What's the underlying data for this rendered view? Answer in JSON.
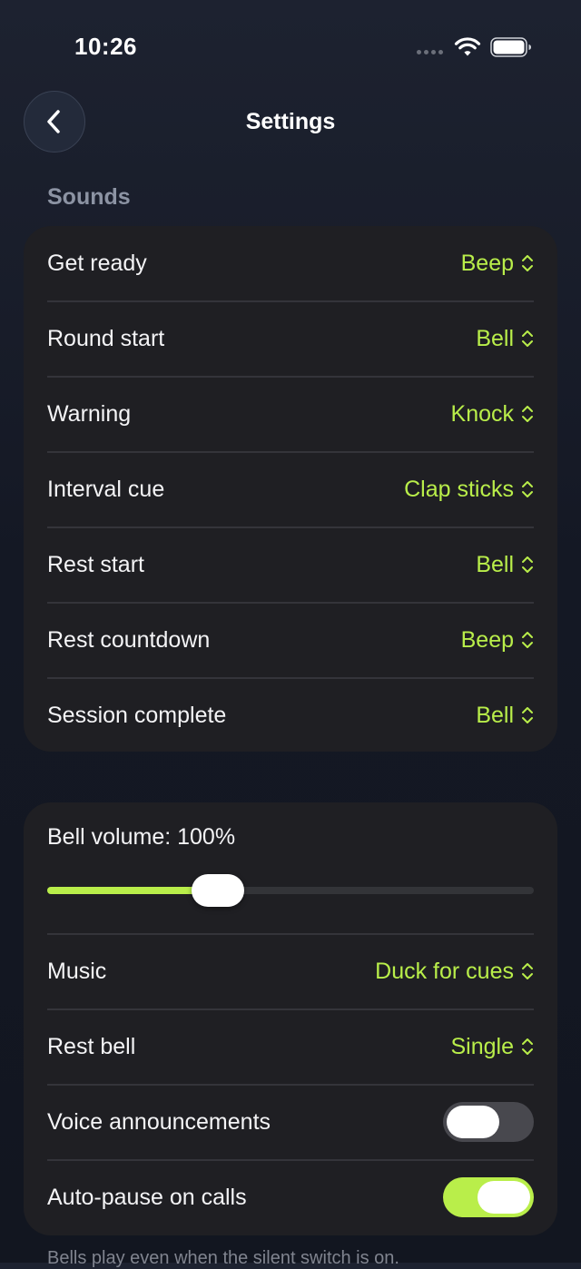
{
  "status_bar": {
    "time": "10:26"
  },
  "header": {
    "title": "Settings",
    "back_icon": "chevron-left-icon"
  },
  "sounds": {
    "header": "Sounds",
    "rows": [
      {
        "label": "Get ready",
        "value": "Beep"
      },
      {
        "label": "Round start",
        "value": "Bell"
      },
      {
        "label": "Warning",
        "value": "Knock"
      },
      {
        "label": "Interval cue",
        "value": "Clap sticks"
      },
      {
        "label": "Rest start",
        "value": "Bell"
      },
      {
        "label": "Rest countdown",
        "value": "Beep"
      },
      {
        "label": "Session complete",
        "value": "Bell"
      }
    ]
  },
  "audio": {
    "volume_label": "Bell volume: 100%",
    "volume_slider_fraction": 0.35,
    "music": {
      "label": "Music",
      "value": "Duck for cues"
    },
    "rest_bell": {
      "label": "Rest bell",
      "value": "Single"
    },
    "voice_announcements": {
      "label": "Voice announcements",
      "enabled": false
    },
    "auto_pause": {
      "label": "Auto-pause on calls",
      "enabled": true
    }
  },
  "footer_note": "Bells play even when the silent switch is on.",
  "colors": {
    "accent": "#b9ee4a",
    "card": "#1f1f23",
    "background": "#141824",
    "section_header": "#8c93a3"
  }
}
